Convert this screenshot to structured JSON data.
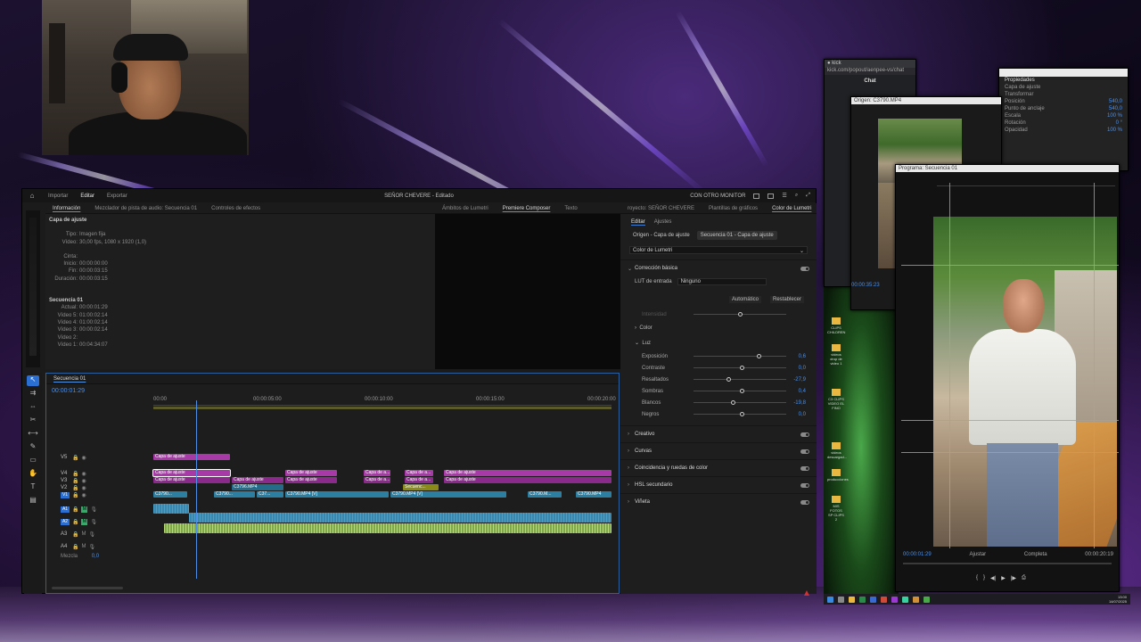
{
  "app": {
    "menu": {
      "home": "⌂",
      "import": "Importar",
      "edit": "Editar",
      "export": "Exportar"
    },
    "title_name": "SEÑOR CHEVERE",
    "title_state": "- Editado",
    "monitor_label": "CON OTRO MONITOR"
  },
  "panels_top": {
    "tabs": [
      "Información",
      "Mezclador de pista de audio: Secuencia 01",
      "Controles de efectos"
    ],
    "mid_tabs": [
      "Ámbitos de Lumetri",
      "Premiere Composer",
      "Texto"
    ]
  },
  "info": {
    "clip_title": "Capa de ajuste",
    "tipo_k": "Tipo:",
    "tipo_v": "Imagen fija",
    "video_k": "Vídeo:",
    "video_v": "30,00 fps, 1080 x 1920 (1,0)",
    "cinta_k": "Cinta:",
    "cinta_v": "",
    "inicio_k": "Inicio:",
    "inicio_v": "00:00:00:00",
    "fin_k": "Fin:",
    "fin_v": "00:00:03:15",
    "duracion_k": "Duración:",
    "duracion_v": "00:00:03:15",
    "seq_title": "Secuencia 01",
    "actual_k": "Actual:",
    "actual_v": "00:00:01:29",
    "v5_k": "Vídeo 5:",
    "v5_v": "01:00:02:14",
    "v4_k": "Vídeo 4:",
    "v4_v": "01:00:02:14",
    "v3_k": "Vídeo 3:",
    "v3_v": "00:00:02:14",
    "v2_k": "Vídeo 2:",
    "v2_v": "",
    "v1_k": "Vídeo 1:",
    "v1_v": "00:04:34:07"
  },
  "lumetri": {
    "tabs": [
      "royecto: SEÑOR CHEVERE",
      "Plantillas de gráficos",
      "Color de Lumetri"
    ],
    "sub_edit": "Editar",
    "sub_settings": "Ajustes",
    "clip_origin": "Origen - Capa de ajuste",
    "clip_seq": "Secuencia 01 - Capa de ajuste",
    "effect_select": "Color de Lumetri",
    "basic": "Corrección básica",
    "lut_label": "LUT de entrada",
    "lut_value": "Ninguno",
    "auto": "Automático",
    "reset": "Restablecer",
    "intensity": "Intensidad",
    "color": "Color",
    "light": "Luz",
    "sliders": [
      {
        "label": "Exposición",
        "value": "0,6",
        "pos": 0.68
      },
      {
        "label": "Contraste",
        "value": "0,0",
        "pos": 0.5
      },
      {
        "label": "Resaltados",
        "value": "-27,9",
        "pos": 0.36
      },
      {
        "label": "Sombras",
        "value": "0,4",
        "pos": 0.5
      },
      {
        "label": "Blancos",
        "value": "-19,8",
        "pos": 0.4
      },
      {
        "label": "Negros",
        "value": "0,0",
        "pos": 0.5
      }
    ],
    "creative": "Creativo",
    "curves": "Curvas",
    "match": "Coincidencia y ruedas de color",
    "hsl": "HSL secundario",
    "vignette": "Viñeta"
  },
  "timeline": {
    "tab": "Secuencia 01",
    "timecode": "00:00:01:29",
    "ruler": [
      "00:00",
      "00:00:05:00",
      "00:00:10:00",
      "00:00:15:00",
      "00:00:20:00"
    ],
    "tracks_v": [
      "V5",
      "V4",
      "V3",
      "V2",
      "V1"
    ],
    "tracks_a": [
      "A1",
      "A2",
      "A3",
      "A4"
    ],
    "mix_label": "Mezcla",
    "mix_value": "0,0",
    "adj": "Capa de ajuste",
    "adj_short": "Capa de a...",
    "adj_short2": "Capa de a...",
    "vid1": "C3790...",
    "vid2": "C3790.MP4 [V]",
    "vid3": "C37...",
    "vid4": "C3796.MP4",
    "vid5": "C3790.MP4 [V]",
    "vid6": "C3790...",
    "vid7": "C3790.M...",
    "vid8": "C3790.MP4",
    "seq_clip": "Secuenc..."
  },
  "right": {
    "chat": "Chat",
    "browser_addr": "kick.com/popout/aenpee-vs/chat",
    "origin_title": "Origen: C3790.MP4",
    "origin_tc": "00:00:35:23",
    "props_title": "Propiedades",
    "props_layer": "Capa de ajuste",
    "props_transform": "Transformar",
    "props_rows": [
      {
        "k": "Posición",
        "v": "540,0"
      },
      {
        "k": "Punto de anclaje",
        "v": "540,0"
      },
      {
        "k": "Escala",
        "v": "100 %"
      },
      {
        "k": "Rotación",
        "v": "0 °"
      },
      {
        "k": "Opacidad",
        "v": "100 %"
      }
    ],
    "program_title": "Programa: Secuencia 01",
    "program_tc": "00:00:01:29",
    "program_zoom": "Ajustar",
    "program_quality": "Completa",
    "program_end": "00:00:20:19",
    "desk_icons": [
      "SANDALIAS",
      "CLIPS CHILDREN",
      "videos drop de video 1",
      "C3 CLIPS VIDEO EL FINO",
      "videos descargad...",
      "producciones",
      "MIS FOTOS SP CLIPS 2"
    ],
    "clock_time": "13:00",
    "clock_date": "14/07/2025"
  }
}
